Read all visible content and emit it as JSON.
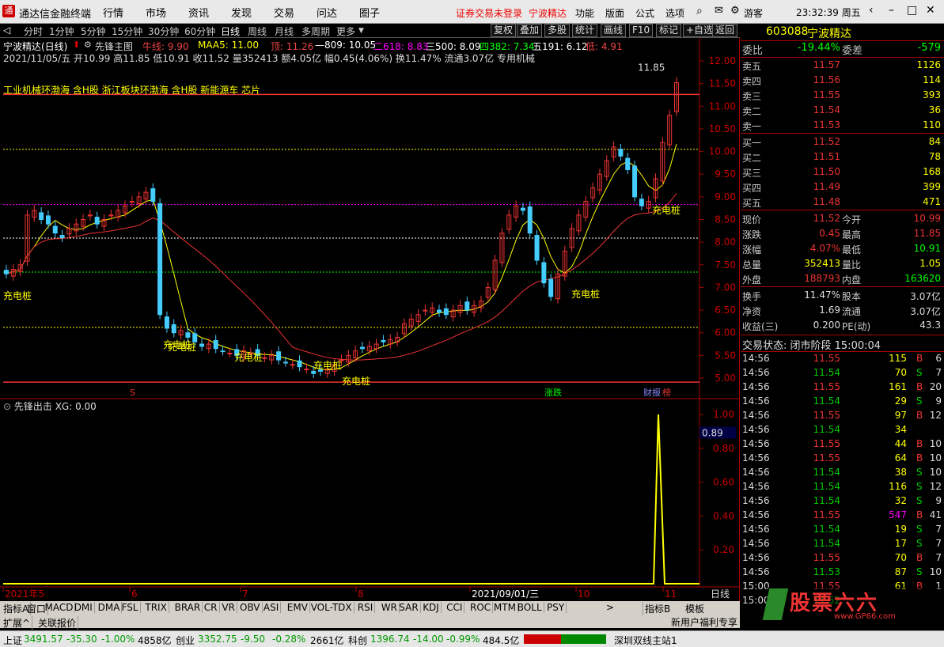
{
  "titlebar": {
    "app_title": "通达信金融终端",
    "menus": [
      "行情",
      "市场",
      "资讯",
      "发现",
      "交易",
      "问达",
      "圈子"
    ],
    "notice": "证券交易未登录",
    "stock": "宁波精达",
    "menus2": [
      "功能",
      "版面",
      "公式",
      "选项"
    ],
    "user": "游客",
    "clock": "23:32:39 周五"
  },
  "toolbar": {
    "periods": [
      "分时",
      "1分钟",
      "5分钟",
      "15分钟",
      "30分钟",
      "60分钟",
      "日线",
      "周线",
      "月线",
      "多周期",
      "更多"
    ],
    "buttons": [
      "复权",
      "叠加",
      "多股",
      "统计",
      "画线",
      "F10",
      "标记",
      "+自选",
      "返回"
    ]
  },
  "chart_header": {
    "line1_name": "宁波精达(日线)",
    "line1_ind": "先锋主图",
    "hist": "牛线: 9.90",
    "maa": "MAA5: 11.00",
    "top": "顶: 11.26",
    "l809": "—809: 10.05",
    "l618": "二618: 8.83",
    "l500": "三500: 8.09",
    "l382": "四382: 7.34",
    "l191": "五191: 6.12",
    "bottom": "低: 4.91",
    "line2": "2021/11/05/五 开10.99 高11.85 低10.91 收11.52 量352413 额4.05亿 幅0.45(4.06%) 换11.47% 流通3.07亿 专用机械",
    "concepts": "工业机械环渤海 含H股 浙江板块环渤海 含H股 新能源车 芯片"
  },
  "chart_data": [
    {
      "type": "candlestick",
      "title": "宁波精达(日线)",
      "ylim": [
        4.6,
        12.3
      ],
      "yticks": [
        "12.00",
        "11.50",
        "11.00",
        "10.50",
        "10.00",
        "9.50",
        "9.00",
        "8.50",
        "8.00",
        "7.50",
        "7.00",
        "6.50",
        "6.00",
        "5.50",
        "5.00"
      ],
      "xticks": [
        "2021年5",
        "6",
        "7",
        "8",
        "2021/09/01/三",
        "10",
        "11"
      ],
      "high_label": "11.85",
      "annotations": [
        "充电桩",
        "充电桩",
        "充电桩",
        "充电桩",
        "充电桩",
        "充电桩",
        "充电桩",
        "充电桩"
      ],
      "markers": [
        "S",
        "涨跌",
        "财报",
        "榜"
      ]
    },
    {
      "type": "line",
      "title": "先锋出击",
      "series": [
        {
          "name": "XG",
          "values": [
            0,
            0,
            0,
            0,
            0,
            1,
            0,
            0
          ]
        }
      ],
      "ylim": [
        0,
        1.1
      ],
      "yticks": [
        "1.00",
        "0.80",
        "0.60",
        "0.40",
        "0.20"
      ],
      "cursor_value": "0.89"
    }
  ],
  "sub_header": "先锋出击 XG: 0.00",
  "period_label": "日线",
  "bottom_tabs": [
    "指标A",
    "窗口",
    "MACD",
    "DMI",
    "DMA",
    "FSL",
    "TRIX",
    "BRAR",
    "CR",
    "VR",
    "OBV",
    "ASI",
    "EMV",
    "VOL-TDX",
    "RSI",
    "WR",
    "SAR",
    "KDJ",
    "CCI",
    "ROC",
    "MTM",
    "BOLL",
    "PSY"
  ],
  "bottom_right": [
    "指标B",
    "模板"
  ],
  "bottom2": [
    "扩展^",
    "关联报价"
  ],
  "quote": {
    "code": "603088",
    "name": "宁波精达",
    "wb": {
      "label": "委比",
      "pct": "-19.44%",
      "label2": "委差",
      "val": "-579"
    },
    "sells": [
      {
        "l": "卖五",
        "p": "11.57",
        "v": "1126"
      },
      {
        "l": "卖四",
        "p": "11.56",
        "v": "114"
      },
      {
        "l": "卖三",
        "p": "11.55",
        "v": "393"
      },
      {
        "l": "卖二",
        "p": "11.54",
        "v": "36"
      },
      {
        "l": "卖一",
        "p": "11.53",
        "v": "110"
      }
    ],
    "buys": [
      {
        "l": "买一",
        "p": "11.52",
        "v": "84"
      },
      {
        "l": "买二",
        "p": "11.51",
        "v": "78"
      },
      {
        "l": "买三",
        "p": "11.50",
        "v": "168"
      },
      {
        "l": "买四",
        "p": "11.49",
        "v": "399"
      },
      {
        "l": "买五",
        "p": "11.48",
        "v": "471"
      }
    ],
    "stats": [
      {
        "l": "现价",
        "v": "11.52",
        "l2": "今开",
        "v2": "10.99"
      },
      {
        "l": "涨跌",
        "v": "0.45",
        "l2": "最高",
        "v2": "11.85"
      },
      {
        "l": "涨幅",
        "v": "4.07%",
        "l2": "最低",
        "v2": "10.91"
      },
      {
        "l": "总量",
        "v": "352413",
        "l2": "量比",
        "v2": "1.05"
      },
      {
        "l": "外盘",
        "v": "188793",
        "l2": "内盘",
        "v2": "163620"
      }
    ],
    "stats2": [
      {
        "l": "换手",
        "v": "11.47%",
        "l2": "股本",
        "v2": "3.07亿"
      },
      {
        "l": "净资",
        "v": "1.69",
        "l2": "流通",
        "v2": "3.07亿"
      },
      {
        "l": "收益(三)",
        "v": "0.200",
        "l2": "PE(动)",
        "v2": "43.3"
      }
    ],
    "trade_state": "交易状态: 闭市阶段 15:00:04",
    "ticks": [
      [
        "14:56",
        "11.55",
        "115",
        "B",
        "6"
      ],
      [
        "14:56",
        "11.54",
        "70",
        "S",
        "7"
      ],
      [
        "14:56",
        "11.55",
        "161",
        "B",
        "20"
      ],
      [
        "14:56",
        "11.54",
        "29",
        "S",
        "9"
      ],
      [
        "14:56",
        "11.55",
        "97",
        "B",
        "12"
      ],
      [
        "14:56",
        "11.54",
        "34",
        "",
        ""
      ],
      [
        "14:56",
        "11.55",
        "44",
        "B",
        "10"
      ],
      [
        "14:56",
        "11.55",
        "64",
        "B",
        "10"
      ],
      [
        "14:56",
        "11.54",
        "38",
        "S",
        "10"
      ],
      [
        "14:56",
        "11.54",
        "116",
        "S",
        "12"
      ],
      [
        "14:56",
        "11.54",
        "32",
        "S",
        "9"
      ],
      [
        "14:56",
        "11.55",
        "547",
        "B",
        "41"
      ],
      [
        "14:56",
        "11.54",
        "19",
        "S",
        "7"
      ],
      [
        "14:56",
        "11.54",
        "17",
        "S",
        "7"
      ],
      [
        "14:56",
        "11.55",
        "70",
        "B",
        "7"
      ],
      [
        "14:56",
        "11.53",
        "87",
        "S",
        "10"
      ],
      [
        "15:00",
        "11.55",
        "61",
        "B",
        "1"
      ],
      [
        "15:00",
        "11.52",
        "",
        "",
        ""
      ]
    ]
  },
  "status": {
    "sh": "上证",
    "sh_v": "3491.57",
    "sh_c": "-35.30",
    "sh_p": "-1.00%",
    "sh_a": "4858亿",
    "cy": "创业",
    "cy_v": "3352.75",
    "cy_c": "-9.50",
    "cy_p": "-0.28%",
    "cy_a": "2661亿",
    "kc": "科创",
    "kc_v": "1396.74",
    "kc_c": "-14.00",
    "kc_p": "-0.99%",
    "kc_a": "484.5亿",
    "server": "深圳双线主站1",
    "news": "新用户福利专享",
    "watermark": "股票六六",
    "watermark_url": "www.GP66.com"
  }
}
